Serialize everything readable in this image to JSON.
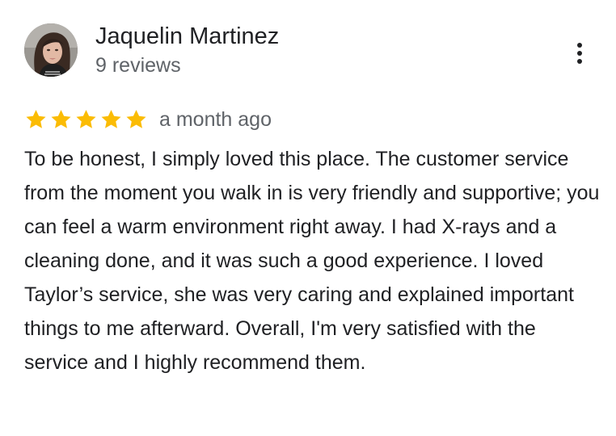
{
  "reviewer": {
    "name": "Jaquelin Martinez",
    "review_count": "9 reviews",
    "avatar_icon": "user-avatar-photo"
  },
  "menu": {
    "icon": "more-vert-icon"
  },
  "rating": {
    "stars": 5,
    "max_stars": 5,
    "star_color": "#fbbc04",
    "date": "a month ago"
  },
  "review": {
    "text": "To be honest, I simply loved this place. The customer service from the moment you walk in is very friendly and supportive; you can feel a warm environment right away. I had X-rays and a cleaning done, and it was such a good experience. I loved Taylor’s service, she was very caring and explained important things to me afterward. Overall, I'm very satisfied with the service and I highly recommend them."
  },
  "colors": {
    "primary_text": "#202124",
    "secondary_text": "#5f6368"
  }
}
